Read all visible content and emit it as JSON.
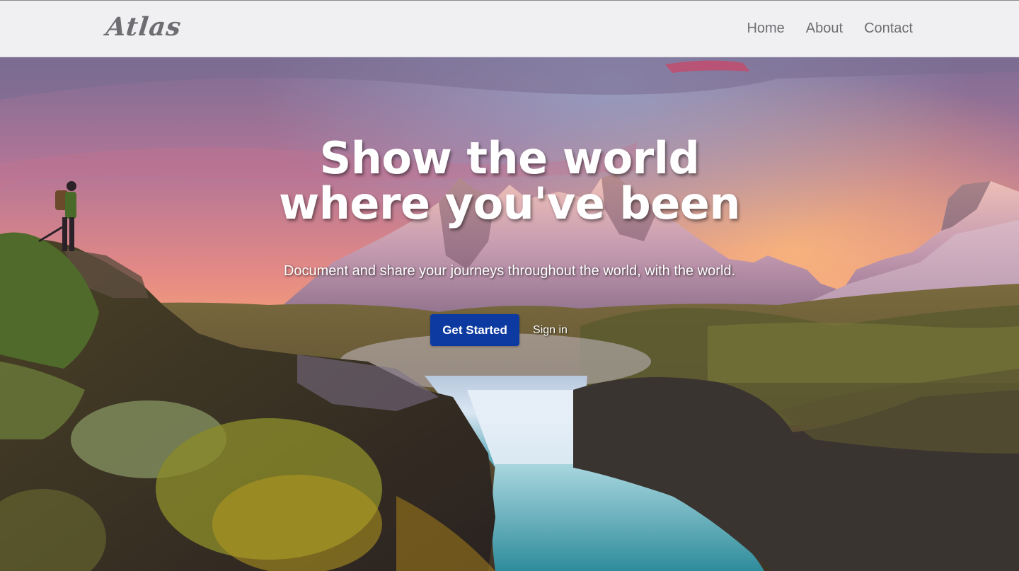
{
  "navbar": {
    "brand": "Atlas",
    "links": [
      "Home",
      "About",
      "Contact"
    ]
  },
  "hero": {
    "headline_line1": "Show the world",
    "headline_line2": "where you've been",
    "subhead": "Document and share your journeys throughout the world, with the world.",
    "primary_cta": "Get Started",
    "secondary_cta": "Sign in"
  },
  "colors": {
    "navbar_bg": "#f0f0f2",
    "nav_text": "#6e6e72",
    "primary_button": "#0d3aa0",
    "hero_text": "#ffffff"
  }
}
